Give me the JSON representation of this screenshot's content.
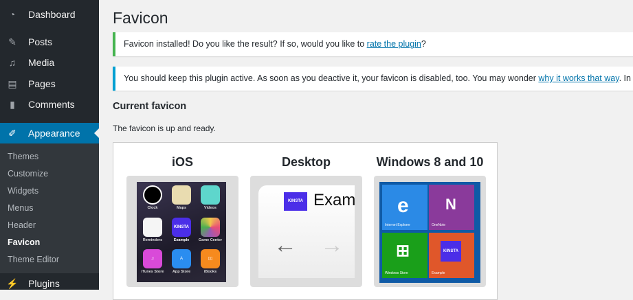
{
  "sidebar": {
    "items": [
      {
        "label": "Dashboard",
        "icon": "dashboard-icon"
      },
      {
        "label": "Posts",
        "icon": "pin-icon"
      },
      {
        "label": "Media",
        "icon": "media-icon"
      },
      {
        "label": "Pages",
        "icon": "pages-icon"
      },
      {
        "label": "Comments",
        "icon": "comment-icon"
      },
      {
        "label": "Appearance",
        "icon": "paintbrush-icon"
      },
      {
        "label": "Plugins",
        "icon": "plug-icon"
      }
    ],
    "submenu": [
      "Themes",
      "Customize",
      "Widgets",
      "Menus",
      "Header",
      "Favicon",
      "Theme Editor"
    ]
  },
  "page": {
    "title": "Favicon",
    "notice1": {
      "text": "Favicon installed! Do you like the result? If so, would you like to ",
      "link": "rate the plugin",
      "end": "?"
    },
    "notice2": {
      "text": "You should keep this plugin active. As soon as you deactive it, your favicon is disabled, too. You may wonder ",
      "link": "why it works that way",
      "end": ". In any case, "
    },
    "heading": "Current favicon",
    "desc": "The favicon is up and ready.",
    "previews": {
      "ios": "iOS",
      "desktop": "Desktop",
      "windows": "Windows 8 and 10"
    },
    "ios_apps": [
      "Clock",
      "Maps",
      "Videos",
      "Reminders",
      "Example",
      "Game Center",
      "iTunes Store",
      "App Store",
      "iBooks"
    ],
    "brand": "KINSTA",
    "desktop_tab": "Exam",
    "win_tiles": [
      "Internet Explorer",
      "OneNote",
      "Windows Store",
      "Example"
    ]
  },
  "colors": {
    "accent": "#0073aa",
    "success": "#46b450",
    "info": "#00a0d2",
    "kinsta": "#4b2ee8"
  }
}
